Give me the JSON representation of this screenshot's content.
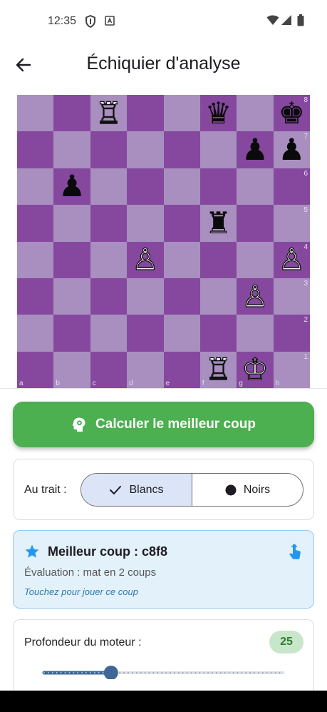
{
  "status_bar": {
    "time": "12:35"
  },
  "app_bar": {
    "title": "Échiquier d'analyse"
  },
  "board": {
    "ranks": [
      "8",
      "7",
      "6",
      "5",
      "4",
      "3",
      "2",
      "1"
    ],
    "files": [
      "a",
      "b",
      "c",
      "d",
      "e",
      "f",
      "g",
      "h"
    ],
    "pieces": {
      "c8": "white-rook",
      "f8": "black-queen",
      "h8": "black-king",
      "g7": "black-pawn",
      "h7": "black-pawn",
      "b6": "black-pawn",
      "f5": "black-rook",
      "d4": "white-pawn",
      "h4": "white-pawn",
      "g3": "white-pawn",
      "f1": "white-rook",
      "g1": "white-king"
    },
    "colors": {
      "light": "#a88fbf",
      "dark": "#86489f"
    }
  },
  "actions": {
    "calculate_label": "Calculer le meilleur coup"
  },
  "side_to_move": {
    "label": "Au trait :",
    "options": [
      "Blancs",
      "Noirs"
    ],
    "selected": "Blancs"
  },
  "best_move": {
    "title": "Meilleur coup : c8f8",
    "evaluation": "Évaluation : mat en 2 coups",
    "hint": "Touchez pour jouer ce coup"
  },
  "engine": {
    "depth_label": "Profondeur du moteur :",
    "depth_value": "25",
    "slider_fraction": 0.28
  },
  "theme": {
    "accent_green": "#4caf50",
    "info_blue": "#2196f3"
  }
}
